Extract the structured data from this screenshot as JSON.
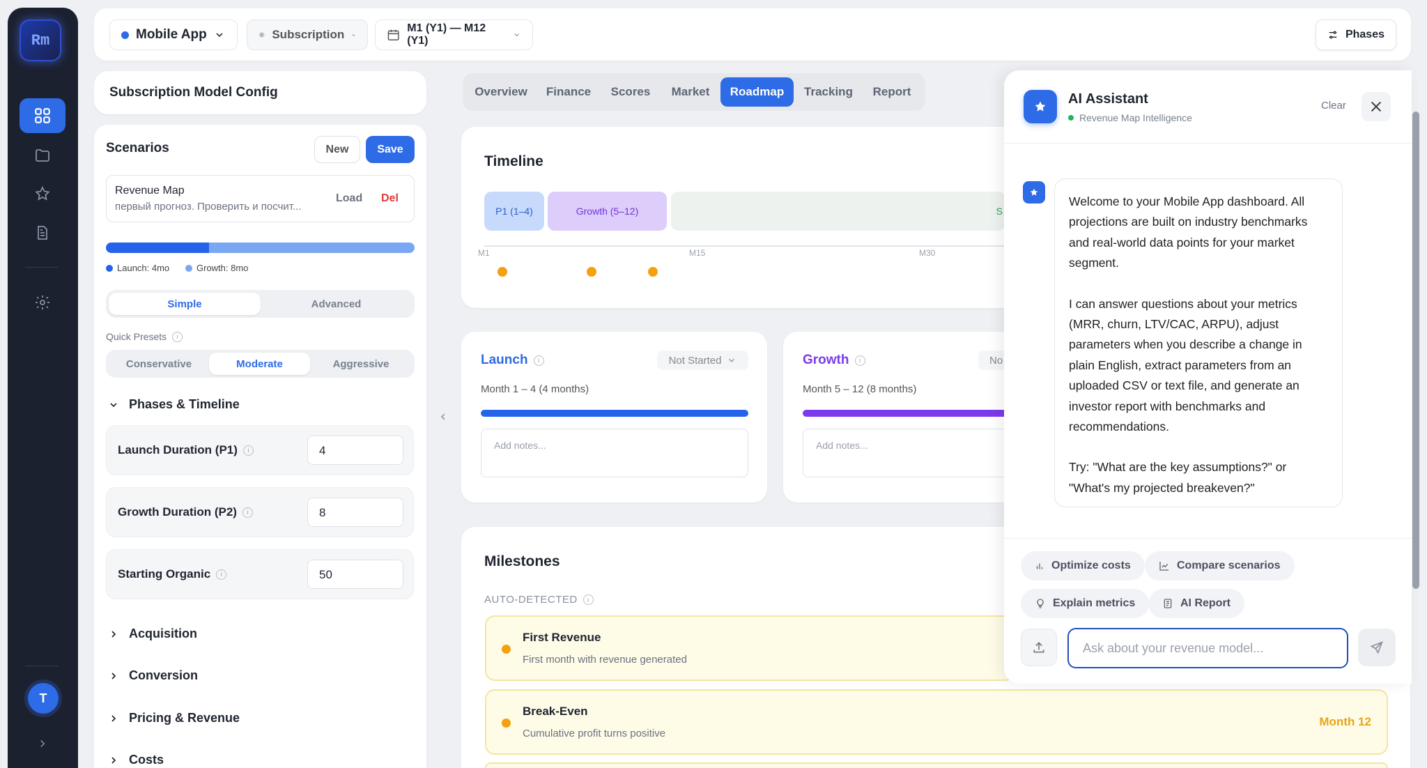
{
  "rail": {
    "logo": "Rm",
    "avatar": "T"
  },
  "topbar": {
    "project": "Mobile App",
    "model": "Subscription",
    "range": "M1 (Y1) — M12 (Y1)",
    "phases_button": "Phases"
  },
  "config": {
    "title": "Subscription Model Config"
  },
  "scenarios": {
    "title": "Scenarios",
    "new_label": "New",
    "save_label": "Save",
    "item": {
      "name": "Revenue Map",
      "desc": "первый прогноз. Проверить и посчит...",
      "load": "Load",
      "del": "Del"
    },
    "progress": {
      "launch_fraction": 0.333
    },
    "legend": {
      "launch": "Launch: 4mo",
      "growth": "Growth: 8mo"
    }
  },
  "mode": {
    "simple": "Simple",
    "advanced": "Advanced",
    "selected": "Simple"
  },
  "presets": {
    "label": "Quick Presets",
    "options": [
      "Conservative",
      "Moderate",
      "Aggressive"
    ],
    "selected": "Moderate"
  },
  "phases_section": {
    "title": "Phases & Timeline",
    "fields": [
      {
        "label": "Launch Duration (P1)",
        "value": "4"
      },
      {
        "label": "Growth Duration (P2)",
        "value": "8"
      },
      {
        "label": "Starting Organic",
        "value": "50"
      }
    ]
  },
  "sections": [
    "Acquisition",
    "Conversion",
    "Pricing & Revenue",
    "Costs"
  ],
  "tabs": [
    "Overview",
    "Finance",
    "Scores",
    "Market",
    "Roadmap",
    "Tracking",
    "Report"
  ],
  "active_tab": "Roadmap",
  "timeline": {
    "title": "Timeline",
    "p1": "P1 (1–4)",
    "growth": "Growth (5–12)",
    "clipped": "S",
    "months": [
      "M1",
      "M15",
      "M30"
    ]
  },
  "phase_cards": [
    {
      "name": "Launch",
      "status": "Not Started",
      "range": "Month 1 – 4 (4 months)",
      "placeholder": "Add notes...",
      "color": "#2e6be6"
    },
    {
      "name": "Growth",
      "status": "No",
      "range": "Month 5 – 12 (8 months)",
      "placeholder": "Add notes...",
      "color": "#7c3aed"
    }
  ],
  "milestones": {
    "title": "Milestones",
    "subtitle": "AUTO-DETECTED",
    "items": [
      {
        "title": "First Revenue",
        "desc": "First month with revenue generated",
        "month": ""
      },
      {
        "title": "Break-Even",
        "desc": "Cumulative profit turns positive",
        "month": "Month 12"
      }
    ]
  },
  "assistant": {
    "title": "AI Assistant",
    "subtitle": "Revenue Map Intelligence",
    "clear": "Clear",
    "message": [
      "Welcome to your Mobile App dashboard. All projections are built on industry benchmarks and real-world data points for your market segment.",
      "I can answer questions about your metrics (MRR, churn, LTV/CAC, ARPU), adjust parameters when you describe a change in plain English, extract parameters from an uploaded CSV or text file, and generate an investor report with benchmarks and recommendations.",
      "Try: \"What are the key assumptions?\" or \"What's my projected breakeven?\""
    ],
    "chips": [
      "Optimize costs",
      "Compare scenarios",
      "Explain metrics",
      "AI Report"
    ],
    "input_placeholder": "Ask about your revenue model..."
  }
}
